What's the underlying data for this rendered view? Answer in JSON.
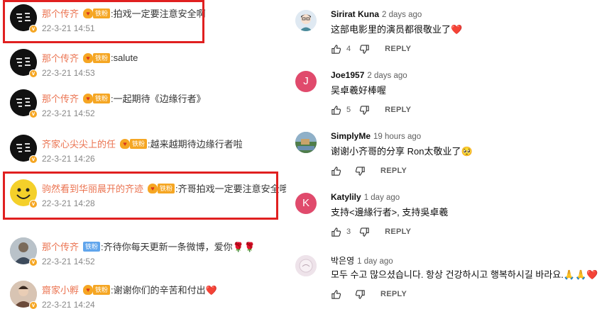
{
  "weibo": {
    "comments": [
      {
        "name": "那个传齐",
        "badge": "铁粉",
        "text": ":拍戏一定要注意安全啊",
        "time": "22-3-21 14:51"
      },
      {
        "name": "那个传齐",
        "badge": "铁粉",
        "text": ":salute",
        "time": "22-3-21 14:53"
      },
      {
        "name": "那个传齐",
        "badge": "铁粉",
        "text": ":一起期待《边缘行者》",
        "time": "22-3-21 14:52"
      },
      {
        "name": "齐家心尖尖上的任",
        "badge": "铁粉",
        "text": ":越来越期待边缘行者啦",
        "time": "22-3-21 14:26"
      },
      {
        "name": "驹然看到华丽晨开的齐迹",
        "badge": "铁粉",
        "text": ":齐哥拍戏一定要注意安全哦。",
        "time": "22-3-21 14:28"
      },
      {
        "name": "那个传齐",
        "badge": "铁粉",
        "text": ":齐待你每天更新一条微博，爱你🌹🌹",
        "time": "22-3-21 14:52"
      },
      {
        "name": "齋家小孵",
        "badge": "铁粉",
        "text": ":谢谢你们的辛苦和付出❤️",
        "time": "22-3-21 14:24"
      }
    ]
  },
  "youtube": {
    "reply_label": "REPLY",
    "comments": [
      {
        "author": "Sirirat Kuna",
        "time": "2 days ago",
        "text": "这部电影里的演员都很敬业了❤️",
        "likes": "4",
        "avatar_letter": "",
        "avatar_color": "#dfe9f2"
      },
      {
        "author": "Joe1957",
        "time": "2 days ago",
        "text": "吴卓羲好棒喔",
        "likes": "5",
        "avatar_letter": "J",
        "avatar_color": "#e04a6c"
      },
      {
        "author": "SimplyMe",
        "time": "19 hours ago",
        "text": "谢谢小齐哥的分享 Ron太敬业了🥺",
        "likes": "",
        "avatar_letter": "",
        "avatar_color": "#6f8fa8"
      },
      {
        "author": "Katylily",
        "time": "1 day ago",
        "text": "支持<邊緣行者>, 支持吳卓羲",
        "likes": "3",
        "avatar_letter": "K",
        "avatar_color": "#e04a6c"
      },
      {
        "author": "박은영",
        "time": "1 day ago",
        "text": "모두 수고 많으셨습니다. 항상 건강하시고 행복하시길 바라요.🙏🙏❤️",
        "likes": "",
        "avatar_letter": "",
        "avatar_color": "#e8dde4"
      }
    ]
  },
  "colors": {
    "weibo_name": "#eb7350",
    "highlight": "#e02020",
    "badge": "#f5a623",
    "youtube_avatar_red": "#e04a6c"
  }
}
